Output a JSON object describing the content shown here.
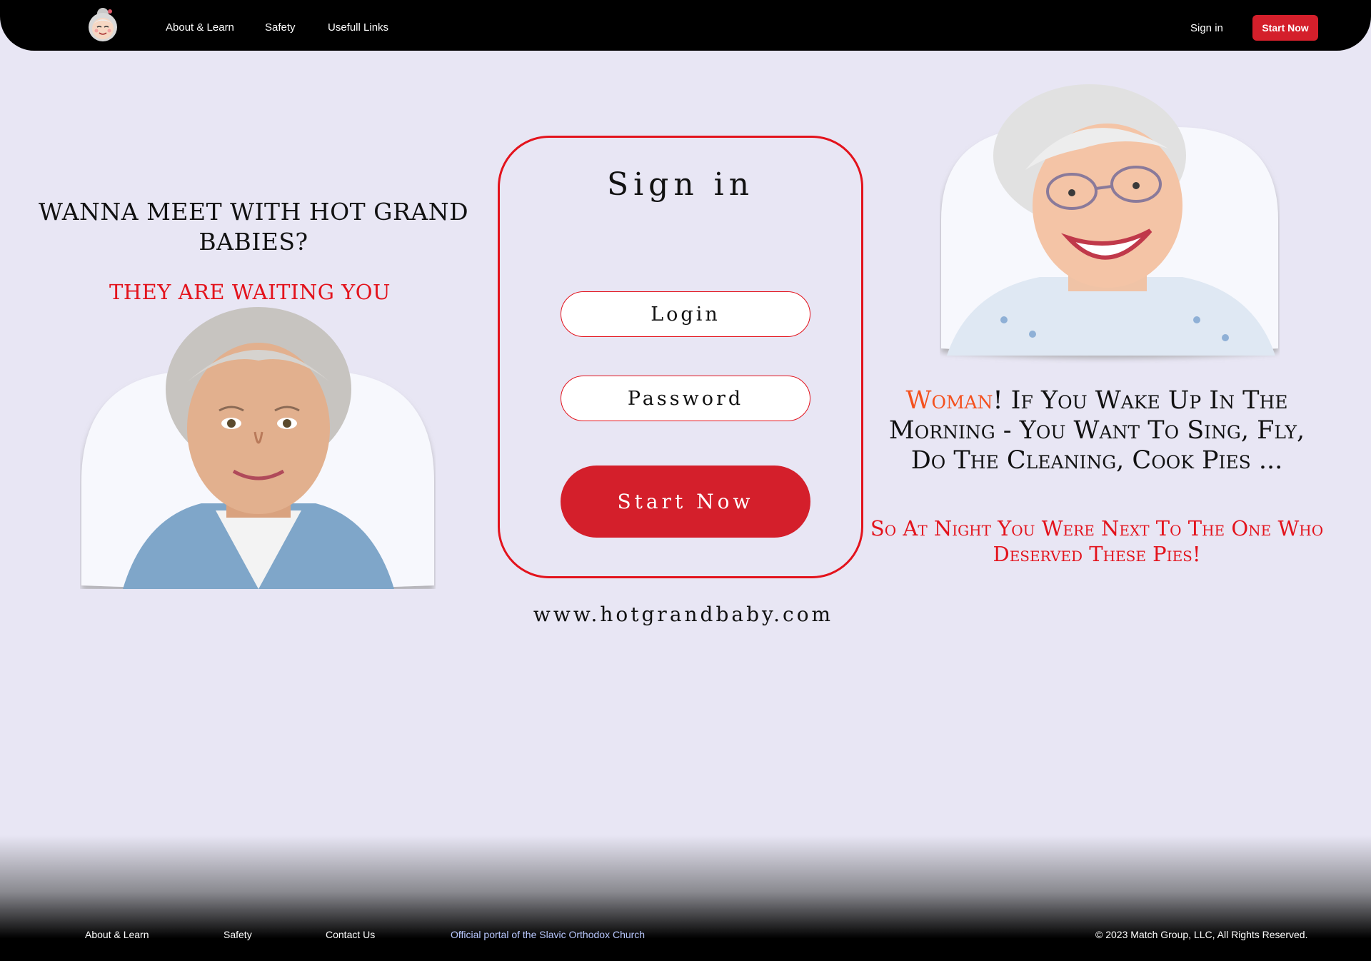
{
  "header": {
    "nav": [
      "About & Learn",
      "Safety",
      "Usefull Links"
    ],
    "signin": "Sign in",
    "start": "Start Now",
    "logo_icon": "grandma-face-icon"
  },
  "left": {
    "title": "WANNA MEET WITH HOT GRAND BABIES?",
    "subtitle": "THEY ARE WAITING YOU",
    "photo_icon": "smiling-grandma-photo"
  },
  "signin_card": {
    "title": "Sign in",
    "login_placeholder": "Login",
    "password_placeholder": "Password",
    "button": "Start Now"
  },
  "site_url": "www.hotgrandbaby.com",
  "right": {
    "accent_word": "Woman",
    "text": "! If You Wake Up In The Morning - You Want To Sing, Fly, Do The Cleaning, Cook Pies ...",
    "red_text": "So At Night You Were Next To The One Who Deserved These Pies!",
    "photo_icon": "laughing-grandma-photo"
  },
  "footer": {
    "links": [
      "About & Learn",
      "Safety",
      "Contact Us"
    ],
    "portal": "Official portal of the Slavic Orthodox Church",
    "copyright": "© 2023 Match Group, LLC, All Rights Reserved."
  },
  "colors": {
    "background": "#e8e6f4",
    "accent_red": "#d41f2b",
    "title_red": "#e3131c",
    "accent_orange": "#f4511e"
  }
}
